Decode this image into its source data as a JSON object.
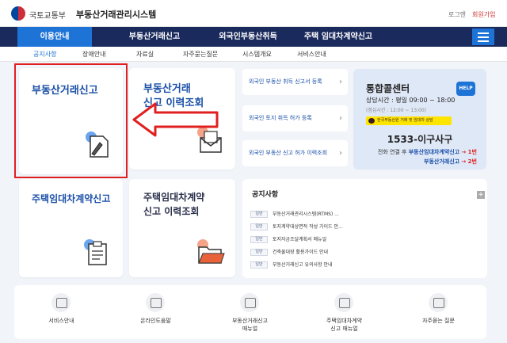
{
  "header": {
    "gov_name": "국토교통부",
    "system_name": "부동산거래관리시스템",
    "login": "로그인",
    "join": "회원가입"
  },
  "main_nav": [
    {
      "label": "이용안내",
      "active": true
    },
    {
      "label": "부동산거래신고"
    },
    {
      "label": "외국인부동산취득"
    },
    {
      "label": "주택 임대차계약신고"
    }
  ],
  "sub_nav": [
    {
      "label": "공지사항",
      "active": true
    },
    {
      "label": "장애안내"
    },
    {
      "label": "자료실"
    },
    {
      "label": "자주묻는질문"
    },
    {
      "label": "시스템개요"
    },
    {
      "label": "서비스안내"
    }
  ],
  "cards": {
    "report": "부동산거래신고",
    "report_history_l1": "부동산거래",
    "report_history_l2": "신고 이력조회",
    "lease": "주택임대차계약신고",
    "lease_history_l1": "주택임대차계약",
    "lease_history_l2": "신고 이력조회"
  },
  "foreign": [
    "외국인 부동산 취득 신고서 등록",
    "외국인 토지 취득 허가 등록",
    "외국인 부동산 신고 허가 이력조회"
  ],
  "call_center": {
    "title": "통합콜센터",
    "hours": "상담시간 : 평일 09:00 ~ 18:00",
    "lunch": "(점심시간 : 12:00 ~ 13:00)",
    "kakao": "한국부동산원 거래 및 임대차 상담",
    "help_badge": "HELP",
    "number": "1533-이구사구",
    "connect_prefix": "전화 연결 후",
    "line1_service": "부동산임대차계약신고",
    "line1_num": "→ 1번",
    "line2_service": "부동산거래신고",
    "line2_num": "→ 2번"
  },
  "notice": {
    "title": "공지사항",
    "plus": "+",
    "items": [
      {
        "badge": "일반",
        "text": "부동산거래관리시스템(RTMS) ..."
      },
      {
        "badge": "일반",
        "text": "토지계약대상면적 작성 가이드 안..."
      },
      {
        "badge": "일반",
        "text": "토지자금조달계획서 매뉴얼"
      },
      {
        "badge": "일반",
        "text": "건축물대장 활용가이드 안내"
      },
      {
        "badge": "일반",
        "text": "부동산거래신고 유의사항 안내"
      }
    ]
  },
  "quick_menu": [
    {
      "label": "서비스안내",
      "icon": "service-guide-icon"
    },
    {
      "label": "온라인도움말",
      "icon": "online-help-icon"
    },
    {
      "label": "부동산거래신고\n매뉴얼",
      "icon": "report-manual-icon"
    },
    {
      "label": "주택임대차계약\n신고 매뉴얼",
      "icon": "lease-manual-icon"
    },
    {
      "label": "자주묻는 질문",
      "icon": "faq-icon"
    }
  ],
  "colors": {
    "nav_bg": "#1a2a5c",
    "accent": "#1e73d6",
    "annotation": "#e02020"
  }
}
